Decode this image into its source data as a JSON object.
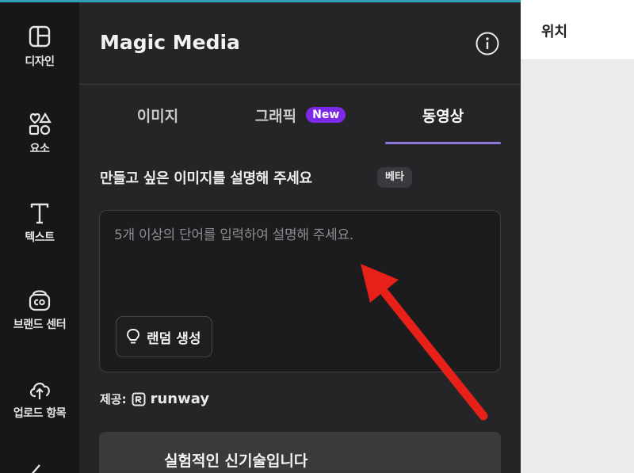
{
  "rail": {
    "items": [
      {
        "label": "디자인",
        "icon": "layout-icon"
      },
      {
        "label": "요소",
        "icon": "shapes-icon"
      },
      {
        "label": "텍스트",
        "icon": "text-icon"
      },
      {
        "label": "브랜드 센터",
        "icon": "brand-icon"
      },
      {
        "label": "업로드 항목",
        "icon": "upload-cloud-icon"
      }
    ]
  },
  "panel": {
    "title": "Magic Media",
    "info_icon": "info-icon",
    "tabs": [
      {
        "label": "이미지",
        "active": false
      },
      {
        "label": "그래픽",
        "active": false,
        "badge": "New"
      },
      {
        "label": "동영상",
        "active": true
      }
    ],
    "prompt_label": "만들고 싶은 이미지를 설명해 주세요",
    "beta_badge": "베타",
    "prompt_placeholder": "5개 이상의 단어를 입력하여 설명해 주세요.",
    "random_button": "랜덤 생성",
    "provided_by_label": "제공:",
    "provider_name": "runway",
    "experimental_button": "실험적인 신기술입니다"
  },
  "right": {
    "title": "위치"
  },
  "colors": {
    "accent": "#8f78d8",
    "new_badge": "#7d2ae8",
    "annotation_arrow": "#e8201a"
  }
}
